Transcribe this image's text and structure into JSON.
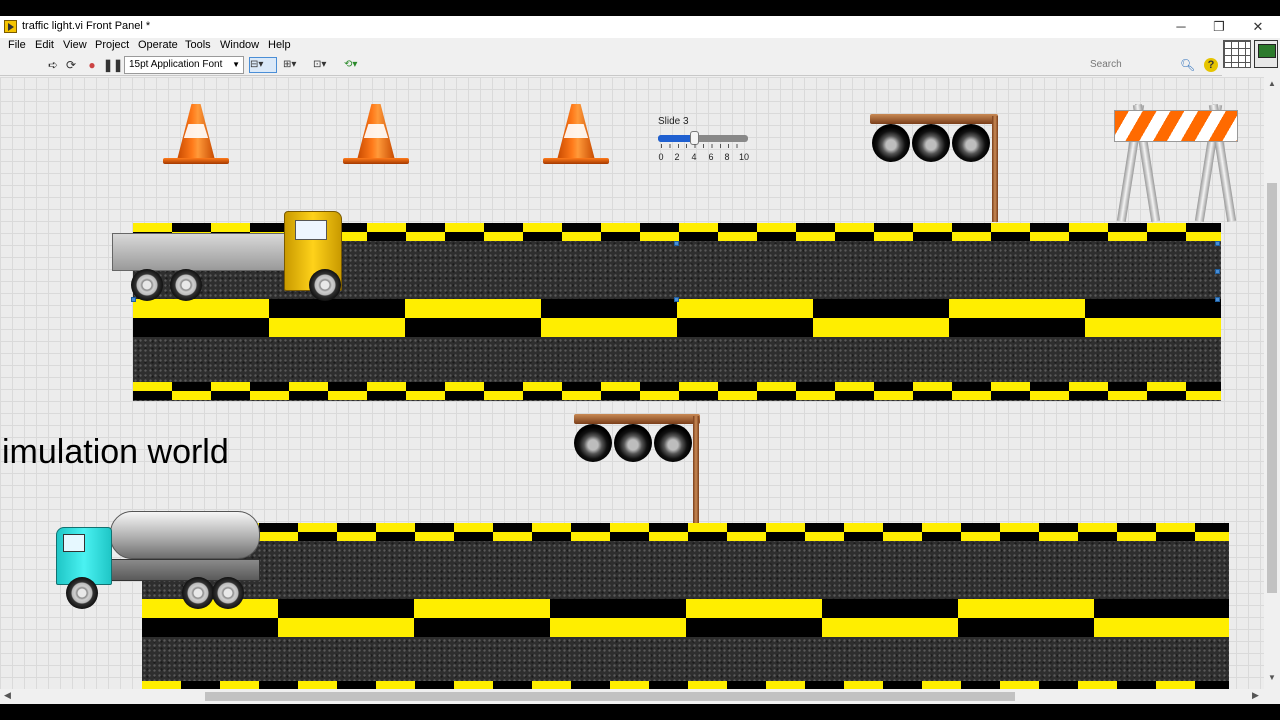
{
  "window": {
    "title": "traffic light.vi Front Panel *",
    "controls": {
      "minimize": "─",
      "restore": "❐",
      "close": "✕"
    }
  },
  "menu": [
    "File",
    "Edit",
    "View",
    "Project",
    "Operate",
    "Tools",
    "Window",
    "Help"
  ],
  "toolbar": {
    "font": "15pt Application Font",
    "search_placeholder": "Search",
    "icons": [
      "run-arrow-icon",
      "run-continuously-icon",
      "abort-icon",
      "pause-icon",
      "text-settings-icon",
      "align-objects-icon",
      "distribute-objects-icon",
      "resize-objects-icon",
      "reorder-icon"
    ]
  },
  "slider": {
    "label": "Slide 3",
    "scale": [
      "0",
      "2",
      "4",
      "6",
      "8",
      "10"
    ],
    "value": 4,
    "min": 0,
    "max": 10,
    "fill_color": "#1e5fd0"
  },
  "panel": {
    "caption": "imulation world"
  },
  "colors": {
    "stripe_yellow": "#ffee00",
    "cone_orange": "#ff7a1a",
    "truck_yellow": "#f5c400",
    "truck_cyan": "#2ee6e6"
  }
}
